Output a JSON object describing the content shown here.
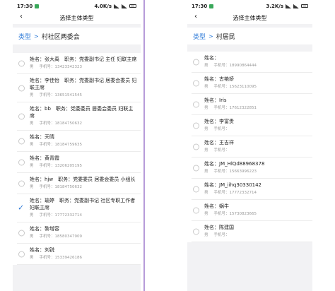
{
  "left": {
    "status": {
      "time": "17:30",
      "net": "4.0K/s"
    },
    "nav": {
      "title": "选择主体类型",
      "back": "‹"
    },
    "crumb": {
      "type": "类型",
      "sep": ">",
      "current": "村社区两委会"
    },
    "items": [
      {
        "line1": "姓名：张大禹　职务：党委副书记 主任 妇联主席",
        "line2a": "男",
        "line2b": "手机号：13423342323",
        "selected": false
      },
      {
        "line1": "姓名：李佳怡　职务：党委副书记 居委会委员 妇联主席",
        "line2a": "男",
        "line2b": "手机号：13651541545",
        "selected": false
      },
      {
        "line1": "姓名：bb　职务：党委委员 居委会委员 妇联主席",
        "line2a": "男",
        "line2b": "手机号：18184750632",
        "selected": false
      },
      {
        "line1": "姓名：天晴",
        "line2a": "男",
        "line2b": "手机号：18184759635",
        "selected": false
      },
      {
        "line1": "姓名：黄青霞",
        "line2a": "男",
        "line2b": "手机号：13206205195",
        "selected": false
      },
      {
        "line1": "姓名：hjw　职务：党委委员 居委会委员 小组长",
        "line2a": "男",
        "line2b": "手机号：18184750632",
        "selected": false
      },
      {
        "line1": "姓名：瑜婷　职务：党委副书记 社区专职工作者 妇联主席",
        "line2a": "男",
        "line2b": "手机号：17772332714",
        "selected": true
      },
      {
        "line1": "姓名：黎增容",
        "line2a": "男",
        "line2b": "手机号：18580347909",
        "selected": false
      },
      {
        "line1": "姓名：刘锐",
        "line2a": "男",
        "line2b": "手机号：15339426186",
        "selected": false
      }
    ]
  },
  "right": {
    "status": {
      "time": "17:30",
      "net": "3.2K/s"
    },
    "nav": {
      "title": "选择主体类型",
      "back": "‹"
    },
    "crumb": {
      "type": "类型",
      "sep": ">",
      "current": "村居民"
    },
    "items": [
      {
        "line1": "姓名：",
        "line2a": "男",
        "line2b": "手机号：18990864444"
      },
      {
        "line1": "姓名：古艳娇",
        "line2a": "男",
        "line2b": "手机号：15623110095"
      },
      {
        "line1": "姓名：Iris",
        "line2a": "男",
        "line2b": "手机号：17612322851"
      },
      {
        "line1": "姓名：李富贵",
        "line2a": "男",
        "line2b": "手机号："
      },
      {
        "line1": "姓名：王吉祥",
        "line2a": "男",
        "line2b": "手机号："
      },
      {
        "line1": "姓名：JM_HlQd88968378",
        "line2a": "男",
        "line2b": "手机号：15663996223"
      },
      {
        "line1": "姓名：JM_iihq30330142",
        "line2a": "男",
        "line2b": "手机号：17772332714"
      },
      {
        "line1": "姓名：蜗牛",
        "line2a": "男",
        "line2b": "手机号：15730823665"
      },
      {
        "line1": "姓名：陈建国",
        "line2a": "男",
        "line2b": "手机号："
      }
    ]
  }
}
